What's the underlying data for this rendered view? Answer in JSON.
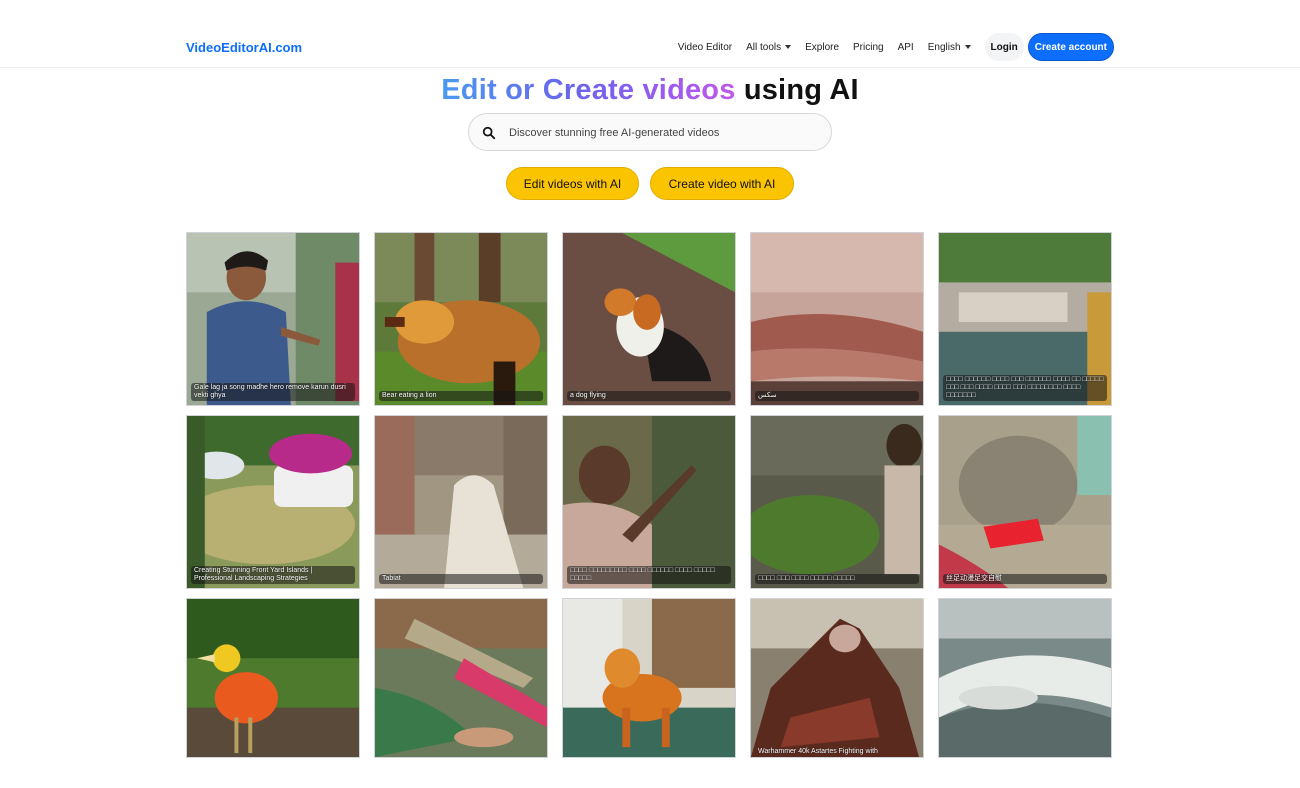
{
  "brand": "VideoEditorAI.com",
  "nav": {
    "video_editor": "Video Editor",
    "all_tools": "All tools",
    "explore": "Explore",
    "pricing": "Pricing",
    "api": "API",
    "language": "English",
    "login": "Login",
    "create_account": "Create account"
  },
  "hero": {
    "part_gradient": "Edit or Create videos",
    "part_plain": " using AI"
  },
  "search": {
    "placeholder": "Discover stunning free AI-generated videos",
    "value": ""
  },
  "cta": {
    "edit": "Edit videos with AI",
    "create": "Create video with AI"
  },
  "videos": [
    {
      "caption": "Gale lag ja song madhe hero remove karun dusri vekti ghya"
    },
    {
      "caption": "Bear eating a lion"
    },
    {
      "caption": "a dog flying"
    },
    {
      "caption": "سکس"
    },
    {
      "caption": "□□□□ □□□□□□ □□□□ □□□ □□□□□□ □□□□ □□ □□□□□ □□□ □□□ □□□□ □□□□ □□□ □□□□□□□□ □□□□ □□□□□□□"
    },
    {
      "caption": "Creating Stunning Front Yard Islands | Professional Landscaping Strategies"
    },
    {
      "caption": "Tabiat"
    },
    {
      "caption": "□□□□ □□□□□□□□□ □□□□ □□□□□□ □□□□ □□□□□ □□□□□"
    },
    {
      "caption": "□□□□ □□□ □□□□ □□□□□ □□□□□"
    },
    {
      "caption": "丝足动漫足交自慰"
    },
    {
      "caption": ""
    },
    {
      "caption": ""
    },
    {
      "caption": ""
    },
    {
      "caption": "Warhammer 40k Astartes Fighting with"
    },
    {
      "caption": ""
    }
  ],
  "colors": {
    "accent_blue": "#0d6efd",
    "cta_yellow": "#fbc400"
  },
  "icons": {
    "search": "search-icon",
    "dropdown": "caret-down-icon"
  }
}
